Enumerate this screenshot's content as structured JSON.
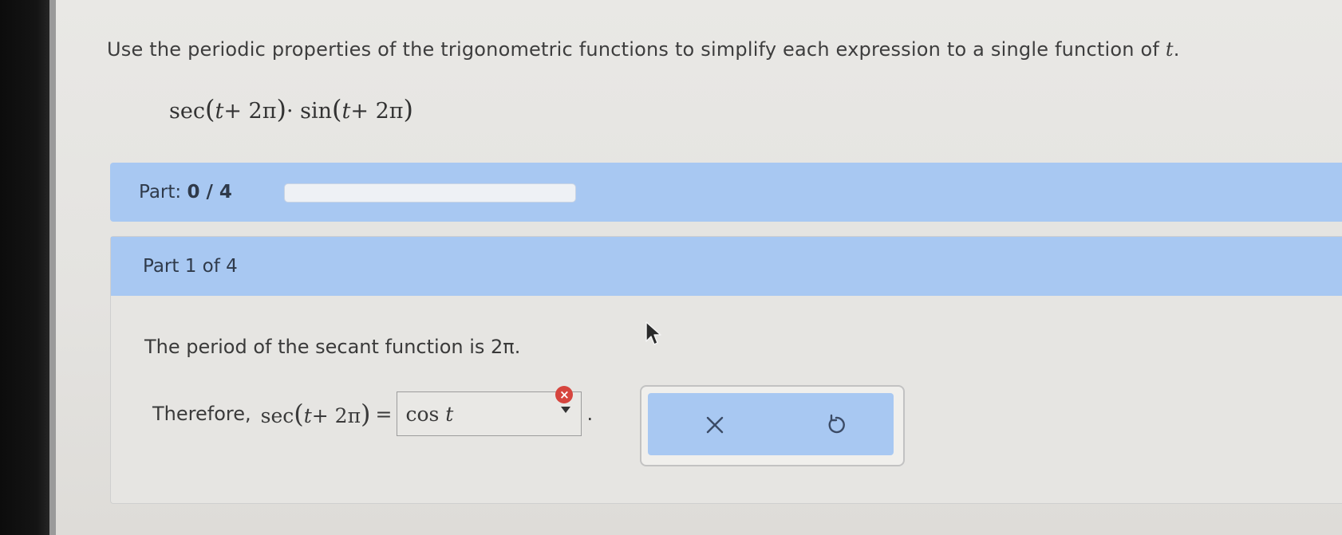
{
  "instructions": {
    "text": "Use the periodic properties of the trigonometric functions to simplify each expression to a single function of",
    "variable": "t",
    "end": "."
  },
  "expression": {
    "f1": "sec",
    "f2": "sin",
    "var": "t",
    "shift": "+ 2π",
    "dot": "·"
  },
  "progress": {
    "label": "Part:",
    "value": "0 / 4",
    "fraction": 0
  },
  "part": {
    "title": "Part 1 of 4",
    "period_text": "The period of the secant function is 2π.",
    "therefore_label": "Therefore,",
    "lhs_func": "sec",
    "lhs_var": "t",
    "lhs_shift": "+ 2π",
    "equals": "=",
    "answer_func": "cos",
    "answer_var": "t",
    "error_symbol": "×",
    "trailing": "."
  },
  "actions": {
    "clear_icon": "x-icon",
    "undo_icon": "undo-icon"
  },
  "colors": {
    "accent": "#a8c8f2",
    "error": "#d6453e"
  }
}
